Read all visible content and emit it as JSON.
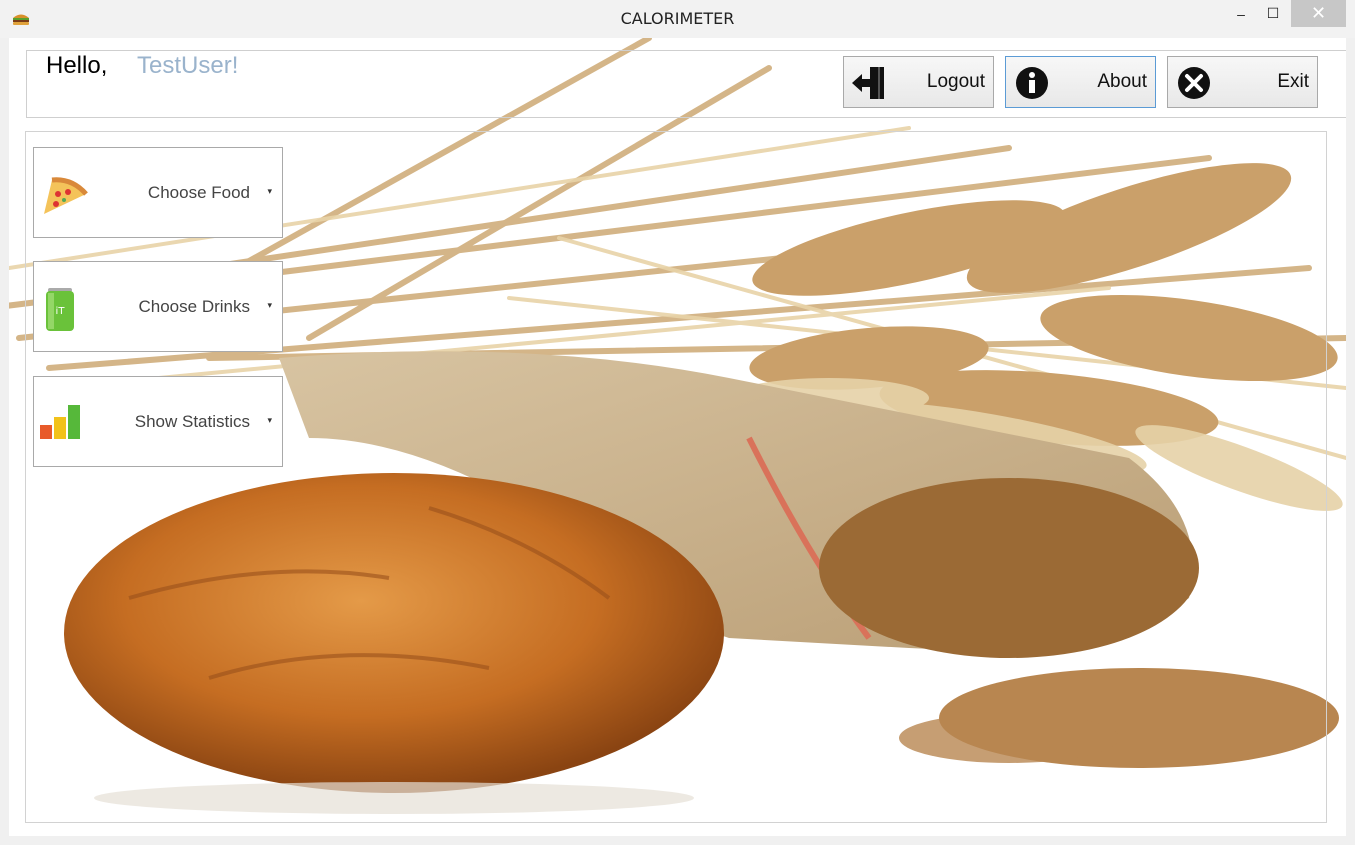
{
  "window": {
    "title": "CALORIMETER",
    "minimize_glyph": "–",
    "maximize_glyph": "☐",
    "close_glyph": "✕"
  },
  "header": {
    "greeting": "Hello,",
    "username": "TestUser!"
  },
  "top_buttons": {
    "logout": {
      "label": "Logout",
      "icon": "logout-door-icon"
    },
    "about": {
      "label": "About",
      "icon": "info-icon"
    },
    "exit": {
      "label": "Exit",
      "icon": "close-circle-icon"
    }
  },
  "side_menu": {
    "food": {
      "label": "Choose Food",
      "icon": "pizza-icon",
      "arrow": "▾"
    },
    "drinks": {
      "label": "Choose Drinks",
      "icon": "drink-can-icon",
      "arrow": "▾"
    },
    "stats": {
      "label": "Show Statistics",
      "icon": "bar-chart-icon",
      "arrow": "▾"
    }
  },
  "colors": {
    "username": "#9ab3cc",
    "about_border": "#5b9bd5",
    "close_bg": "#c7c7c7"
  }
}
